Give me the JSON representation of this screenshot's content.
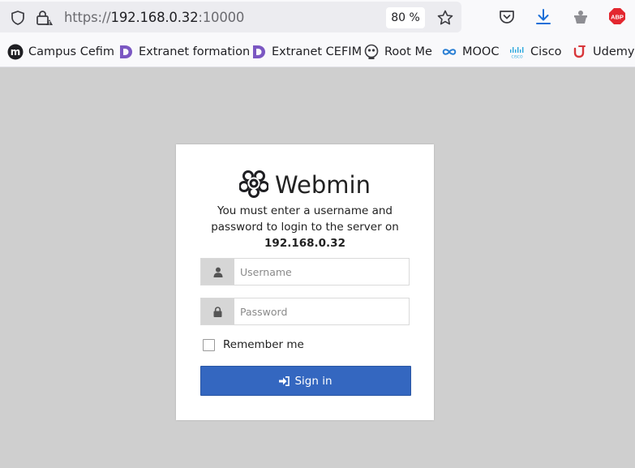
{
  "browser": {
    "url": {
      "scheme": "https://",
      "host": "192.168.0.32",
      "port": ":10000"
    },
    "zoom": "80 %",
    "icons": [
      "shield-icon",
      "lock-warning-icon",
      "star-icon",
      "pocket-icon",
      "download-icon",
      "extension-icon",
      "adblock-icon"
    ],
    "adblock_label": "ABP"
  },
  "bookmarks": [
    {
      "label": "Campus Cefim",
      "icon": "campus-cefim-icon"
    },
    {
      "label": "Extranet formation",
      "icon": "extranet-d-icon"
    },
    {
      "label": "Extranet CEFIM",
      "icon": "extranet-d-icon"
    },
    {
      "label": "Root Me",
      "icon": "root-me-icon"
    },
    {
      "label": "MOOC",
      "icon": "infinity-icon"
    },
    {
      "label": "Cisco",
      "icon": "cisco-icon"
    },
    {
      "label": "Udemy",
      "icon": "udemy-icon"
    }
  ],
  "login": {
    "brand": "Webmin",
    "message": "You must enter a username and password to login to the server on",
    "server": "192.168.0.32",
    "username_placeholder": "Username",
    "password_placeholder": "Password",
    "remember_label": "Remember me",
    "signin_label": "Sign in"
  },
  "colors": {
    "page_background": "#cfcfcf",
    "signin_button": "#3467c0",
    "input_addon": "#d6d6d6",
    "adblock_red": "#e3272f"
  }
}
